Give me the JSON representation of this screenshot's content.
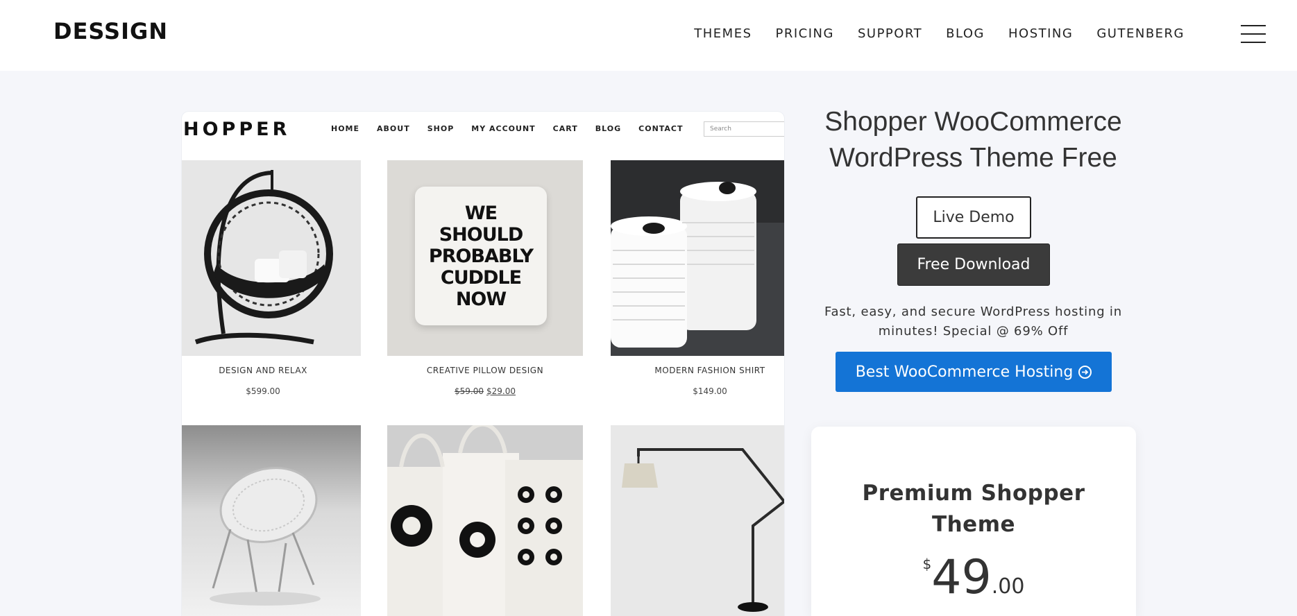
{
  "header": {
    "logo": "DESSIGN",
    "nav": [
      "THEMES",
      "PRICING",
      "SUPPORT",
      "BLOG",
      "HOSTING",
      "GUTENBERG"
    ]
  },
  "preview": {
    "logo": "HOPPER",
    "nav": [
      "HOME",
      "ABOUT",
      "SHOP",
      "MY ACCOUNT",
      "CART",
      "BLOG",
      "CONTACT"
    ],
    "search_placeholder": "Search",
    "products": [
      {
        "name": "DESIGN AND RELAX",
        "price": "$599.00"
      },
      {
        "name": "CREATIVE PILLOW DESIGN",
        "old_price": "$59.00",
        "price": "$29.00"
      },
      {
        "name": "MODERN FASHION SHIRT",
        "price": "$149.00"
      }
    ],
    "pillow_text": [
      "WE",
      "SHOULD",
      "PROBABLY",
      "CUDDLE",
      "NOW"
    ]
  },
  "theme": {
    "title_line1": "Shopper WooCommerce",
    "title_line2": "WordPress Theme Free",
    "live_demo_label": "Live Demo",
    "free_download_label": "Free Download",
    "hosting_text": "Fast, easy, and secure WordPress hosting in minutes! Special @ 69% Off",
    "hosting_button_label": "Best WooCommerce Hosting"
  },
  "premium": {
    "title_line1": "Premium Shopper",
    "title_line2": "Theme",
    "currency": "$",
    "price_int": "49",
    "price_cents": ".00"
  },
  "colors": {
    "accent_blue": "#1474d6",
    "dark_button": "#3b3b3b",
    "page_bg": "#f5f6fa"
  }
}
